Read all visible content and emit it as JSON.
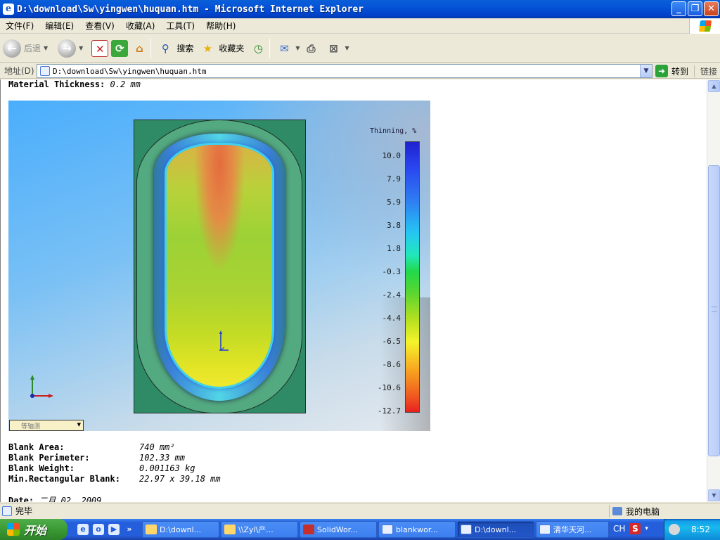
{
  "window": {
    "title": "D:\\download\\Sw\\yingwen\\huquan.htm - Microsoft Internet Explorer"
  },
  "menu": [
    "文件(F)",
    "编辑(E)",
    "查看(V)",
    "收藏(A)",
    "工具(T)",
    "帮助(H)"
  ],
  "toolbar": {
    "back_label": "后退",
    "search_label": "搜索",
    "favorites_label": "收藏夹"
  },
  "address": {
    "label": "地址(D)",
    "url": "D:\\download\\Sw\\yingwen\\huquan.htm",
    "go_label": "转到",
    "links_label": "链接"
  },
  "page": {
    "material_label": "Material Thickness:",
    "material_value": "0.2 mm",
    "legend_title": "Thinning, %",
    "legend_ticks": [
      "10.0",
      "7.9",
      "5.9",
      "3.8",
      "1.8",
      "-0.3",
      "-2.4",
      "-4.4",
      "-6.5",
      "-8.6",
      "-10.6",
      "-12.7"
    ],
    "colors": {
      "max": "#2020d0",
      "zero": "#22d84a",
      "min": "#e82020"
    },
    "view_select": "等轴测",
    "stats": [
      {
        "key": "Blank Area:",
        "value": "740 mm²"
      },
      {
        "key": "Blank Perimeter:",
        "value": "102.33 mm"
      },
      {
        "key": "Blank Weight:",
        "value": "0.001163 kg"
      },
      {
        "key": "Min.Rectangular Blank:",
        "value": "22.97 x 39.18 mm"
      }
    ],
    "date_label": "Date:",
    "date_value": "二月 02, 2009"
  },
  "status": {
    "text": "完毕",
    "zone": "我的电脑"
  },
  "taskbar": {
    "start_label": "开始",
    "tasks": [
      "D:\\downl...",
      "\\\\Zyl\\产...",
      "SolidWor...",
      "blankwor...",
      "D:\\downl...",
      "清华天河..."
    ],
    "active_index": 4,
    "ime": "CH",
    "clock": "8:52"
  }
}
